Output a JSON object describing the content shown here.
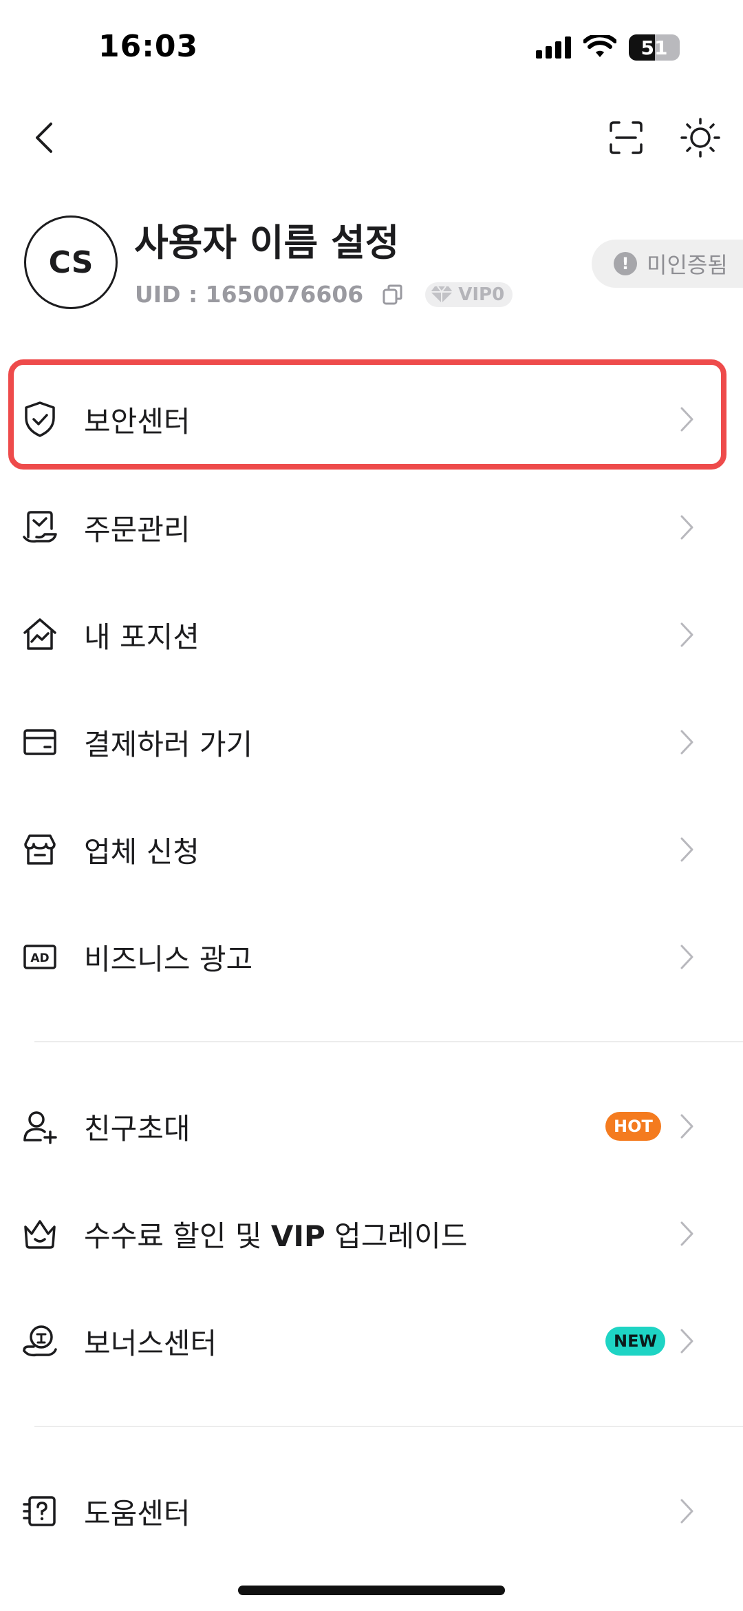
{
  "status_bar": {
    "time": "16:03",
    "battery": "51",
    "battery_level": 0.51
  },
  "nav": {
    "back_icon": "chevron-left-icon",
    "scan_icon": "scan-icon",
    "theme_icon": "sun-icon"
  },
  "profile": {
    "avatar_initials": "CS",
    "username": "사용자 이름 설정",
    "uid": "UID : 1650076606",
    "vip": "VIP0",
    "verification_status": "미인증됨"
  },
  "menu": {
    "group1": [
      {
        "label": "보안센터",
        "icon": "shield-check-icon"
      },
      {
        "label": "주문관리",
        "icon": "order-icon"
      },
      {
        "label": "내 포지션",
        "icon": "house-chart-icon"
      },
      {
        "label": "결제하러 가기",
        "icon": "wallet-icon"
      },
      {
        "label": "업체 신청",
        "icon": "store-icon"
      },
      {
        "label": "비즈니스 광고",
        "icon": "ad-icon"
      }
    ],
    "group2": [
      {
        "label": "친구초대",
        "icon": "add-user-icon",
        "tag": "HOT"
      },
      {
        "label_prefix": "수수료 할인 및 ",
        "label_bold": "VIP",
        "label_suffix": " 업그레이드",
        "icon": "crown-icon"
      },
      {
        "label": "보너스센터",
        "icon": "bonus-icon",
        "tag": "NEW"
      }
    ],
    "group3": [
      {
        "label": "도움센터",
        "icon": "help-icon"
      }
    ]
  },
  "colors": {
    "highlight": "#ee4b4b",
    "hot_tag": "#f47b1f",
    "new_tag": "#1ed4c4"
  }
}
